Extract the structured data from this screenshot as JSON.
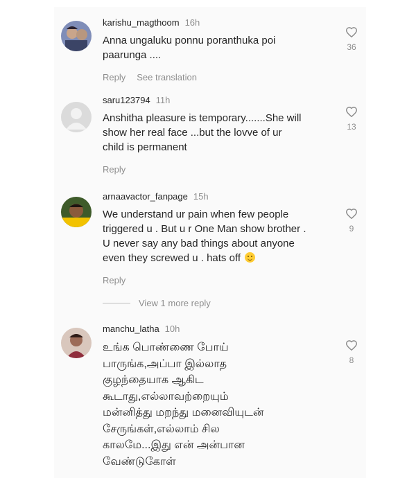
{
  "comments": [
    {
      "username": "karishu_magthoom",
      "time": "16h",
      "lines": [
        "Anna ungaluku ponnu poranthuka poi",
        "paarunga ...."
      ],
      "reply_label": "Reply",
      "translate_label": "See translation",
      "likes": "36",
      "avatar_icon": "profile-photo"
    },
    {
      "username": "saru123794",
      "time": "11h",
      "lines": [
        "Anshitha pleasure is temporary.......She will",
        "show her real face ...but the lovve of ur",
        "child is permanent"
      ],
      "reply_label": "Reply",
      "likes": "13",
      "avatar_icon": "default-avatar"
    },
    {
      "username": "arnaavactor_fanpage",
      "time": "15h",
      "lines": [
        "We understand ur pain when few people",
        "triggered u . But u r One Man show brother .",
        "U never say any bad things about anyone",
        "even they screwed u . hats off"
      ],
      "emoji": "slightly-smiling-face",
      "reply_label": "Reply",
      "likes": "9",
      "avatar_icon": "profile-photo"
    },
    {
      "username": "manchu_latha",
      "time": "10h",
      "lines": [
        "உங்க பொண்ணை போய்",
        "பாருங்க,அப்பா இல்லாத",
        "குழந்தையாக ஆகிட",
        "கூடாது,எல்லாவற்றையும்",
        "மன்னித்து மறந்து மனைவியுடன்",
        "சேருங்கள்,எல்லாம் சில",
        "காலமே...இது என் அன்பான",
        "வேண்டுகோள்"
      ],
      "likes": "8",
      "avatar_icon": "profile-photo"
    }
  ],
  "view_more_label": "View 1 more reply",
  "colors": {
    "text": "#262626",
    "muted": "#8e8e8e",
    "background": "#fafafa"
  }
}
